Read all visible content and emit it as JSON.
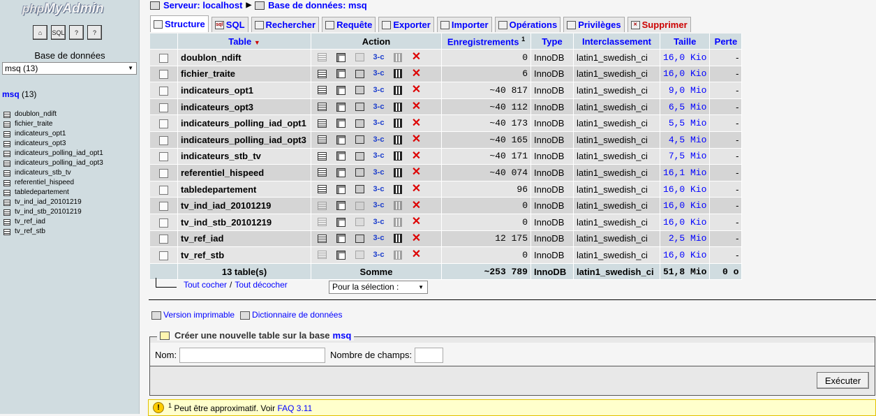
{
  "nav": {
    "logo_php": "php",
    "logo_myadmin": "MyAdmin",
    "icons": [
      "home-icon",
      "sql-icon",
      "query-window-icon",
      "documentation-icon"
    ],
    "icon_labels": [
      "⌂",
      "SQL",
      "?",
      "?"
    ],
    "db_label": "Base de données",
    "db_select_value": "msq (13)",
    "current_db_name": "msq",
    "current_db_count": "(13)",
    "tables": [
      "doublon_ndift",
      "fichier_traite",
      "indicateurs_opt1",
      "indicateurs_opt3",
      "indicateurs_polling_iad_opt1",
      "indicateurs_polling_iad_opt3",
      "indicateurs_stb_tv",
      "referentiel_hispeed",
      "tabledepartement",
      "tv_ind_iad_20101219",
      "tv_ind_stb_20101219",
      "tv_ref_iad",
      "tv_ref_stb"
    ]
  },
  "breadcrumb": {
    "server": "Serveur: localhost",
    "database": "Base de données: msq"
  },
  "tabs": [
    {
      "label": "Structure",
      "icon": "structure-icon",
      "active": true
    },
    {
      "label": "SQL",
      "icon": "sql-icon",
      "active": false
    },
    {
      "label": "Rechercher",
      "icon": "search-icon",
      "active": false
    },
    {
      "label": "Requête",
      "icon": "query-icon",
      "active": false
    },
    {
      "label": "Exporter",
      "icon": "export-icon",
      "active": false
    },
    {
      "label": "Importer",
      "icon": "import-icon",
      "active": false
    },
    {
      "label": "Opérations",
      "icon": "operations-icon",
      "active": false
    },
    {
      "label": "Privilèges",
      "icon": "privileges-icon",
      "active": false
    },
    {
      "label": "Supprimer",
      "icon": "drop-icon",
      "active": false
    }
  ],
  "table": {
    "headers": {
      "table": "Table",
      "action": "Action",
      "records": "Enregistrements",
      "records_sup": "1",
      "type": "Type",
      "collation": "Interclassement",
      "size": "Taille",
      "overhead": "Perte"
    },
    "rows": [
      {
        "name": "doublon_ndift",
        "records": "0",
        "type": "InnoDB",
        "collation": "latin1_swedish_ci",
        "size": "16,0 Kio",
        "overhead": "-",
        "empty": true
      },
      {
        "name": "fichier_traite",
        "records": "6",
        "type": "InnoDB",
        "collation": "latin1_swedish_ci",
        "size": "16,0 Kio",
        "overhead": "-",
        "empty": false
      },
      {
        "name": "indicateurs_opt1",
        "records": "~40 817",
        "type": "InnoDB",
        "collation": "latin1_swedish_ci",
        "size": "9,0 Mio",
        "overhead": "-",
        "empty": false
      },
      {
        "name": "indicateurs_opt3",
        "records": "~40 112",
        "type": "InnoDB",
        "collation": "latin1_swedish_ci",
        "size": "6,5 Mio",
        "overhead": "-",
        "empty": false
      },
      {
        "name": "indicateurs_polling_iad_opt1",
        "records": "~40 173",
        "type": "InnoDB",
        "collation": "latin1_swedish_ci",
        "size": "5,5 Mio",
        "overhead": "-",
        "empty": false
      },
      {
        "name": "indicateurs_polling_iad_opt3",
        "records": "~40 165",
        "type": "InnoDB",
        "collation": "latin1_swedish_ci",
        "size": "4,5 Mio",
        "overhead": "-",
        "empty": false
      },
      {
        "name": "indicateurs_stb_tv",
        "records": "~40 171",
        "type": "InnoDB",
        "collation": "latin1_swedish_ci",
        "size": "7,5 Mio",
        "overhead": "-",
        "empty": false
      },
      {
        "name": "referentiel_hispeed",
        "records": "~40 074",
        "type": "InnoDB",
        "collation": "latin1_swedish_ci",
        "size": "16,1 Mio",
        "overhead": "-",
        "empty": false
      },
      {
        "name": "tabledepartement",
        "records": "96",
        "type": "InnoDB",
        "collation": "latin1_swedish_ci",
        "size": "16,0 Kio",
        "overhead": "-",
        "empty": false
      },
      {
        "name": "tv_ind_iad_20101219",
        "records": "0",
        "type": "InnoDB",
        "collation": "latin1_swedish_ci",
        "size": "16,0 Kio",
        "overhead": "-",
        "empty": true
      },
      {
        "name": "tv_ind_stb_20101219",
        "records": "0",
        "type": "InnoDB",
        "collation": "latin1_swedish_ci",
        "size": "16,0 Kio",
        "overhead": "-",
        "empty": true
      },
      {
        "name": "tv_ref_iad",
        "records": "12 175",
        "type": "InnoDB",
        "collation": "latin1_swedish_ci",
        "size": "2,5 Mio",
        "overhead": "-",
        "empty": false
      },
      {
        "name": "tv_ref_stb",
        "records": "0",
        "type": "InnoDB",
        "collation": "latin1_swedish_ci",
        "size": "16,0 Kio",
        "overhead": "-",
        "empty": true
      }
    ],
    "footer": {
      "count": "13 table(s)",
      "sum_label": "Somme",
      "records": "~253 789",
      "type": "InnoDB",
      "collation": "latin1_swedish_ci",
      "size": "51,8 Mio",
      "overhead": "0 o"
    }
  },
  "selection": {
    "check_all": "Tout cocher",
    "separator": "/",
    "uncheck_all": "Tout décocher",
    "with_selected": "Pour la sélection :"
  },
  "links": {
    "printable": "Version imprimable",
    "dictionary": "Dictionnaire de données"
  },
  "create": {
    "legend": "Créer une nouvelle table sur la base",
    "db": "msq",
    "name_label": "Nom:",
    "name_value": "",
    "fields_label": "Nombre de champs:",
    "fields_value": "",
    "execute": "Exécuter"
  },
  "notice": {
    "sup": "1",
    "text": "Peut être approximatif. Voir",
    "link": "FAQ 3.11"
  }
}
